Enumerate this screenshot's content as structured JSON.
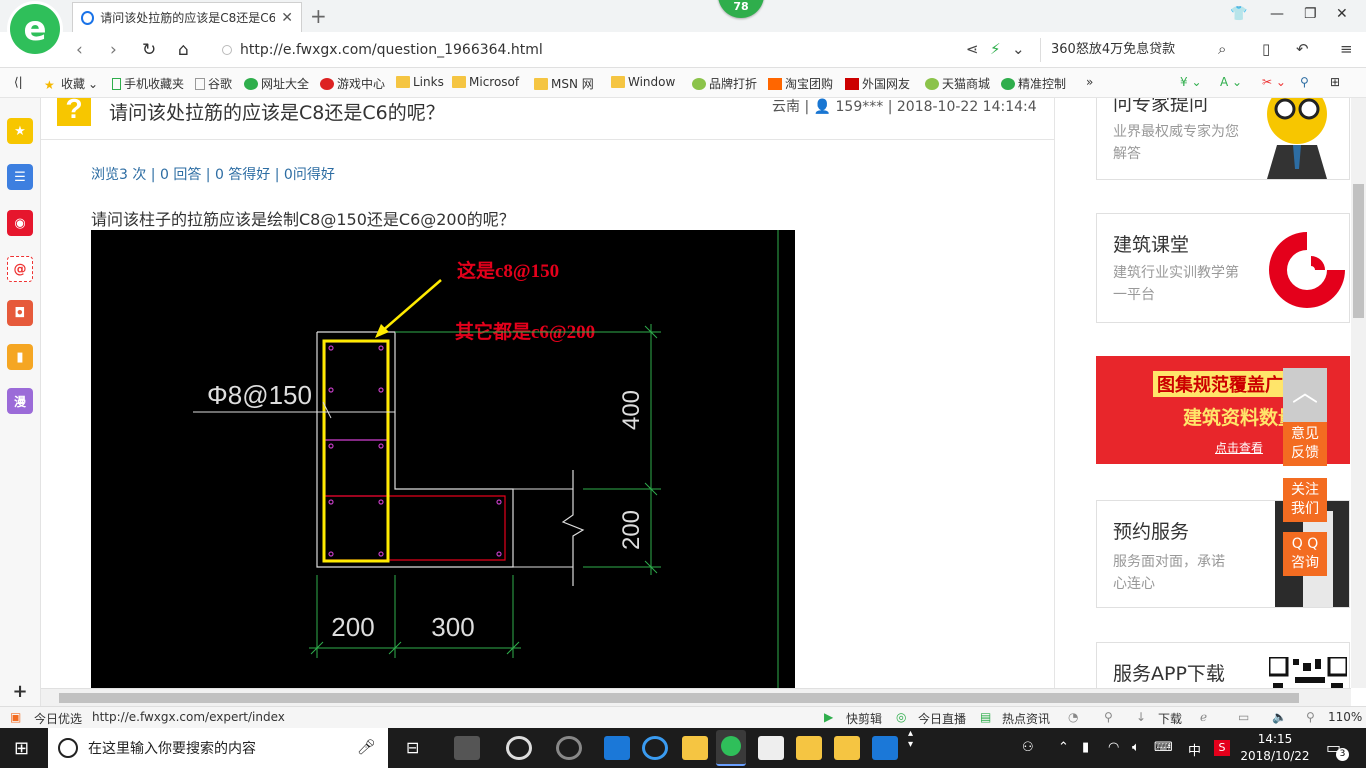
{
  "browser": {
    "tab_title": "请问该处拉筋的应该是C8还是C6的呢？",
    "badge_count": "78",
    "url": "http://e.fwxgx.com/question_1966364.html",
    "search_text": "360怒放4万免息贷款"
  },
  "bookmarks": [
    "收藏",
    "手机收藏夹",
    "谷歌",
    "网址大全",
    "游戏中心",
    "Links",
    "Microsof",
    "MSN 网",
    "Window",
    "品牌打折",
    "淘宝团购",
    "外国网友",
    "天猫商城",
    "精准控制"
  ],
  "question": {
    "title": "请问该处拉筋的应该是C8还是C6的呢？",
    "region": "云南",
    "user": "159***",
    "datetime": "2018-10-22 14:14:4",
    "stats": "浏览3 次 | 0 回答 | 0 答得好 | 0问得好",
    "body": "请问该柱子的拉筋应该是绘制C8@150还是C6@200的呢？"
  },
  "drawing": {
    "rebar_label": "Φ8@150",
    "annot1": "这是c8@150",
    "annot2": "其它都是c6@200",
    "dim_400": "400",
    "dim_200v": "200",
    "dim_200h": "200",
    "dim_300": "300"
  },
  "sidebar_cards": {
    "expert_title": "问专家提问",
    "expert_desc": "业界最权威专家为您解答",
    "class_title": "建筑课堂",
    "class_desc": "建筑行业实训教学第一平台",
    "banner_line1": "图集规范覆盖广",
    "banner_line2": "建筑资料数量多",
    "banner_cta": "点击查看",
    "service_title": "预约服务",
    "service_desc": "服务面对面，承诺心连心",
    "app_title": "服务APP下载"
  },
  "float_buttons": [
    "意见反馈",
    "关注我们",
    "Q Q咨询"
  ],
  "statusbar": {
    "left_label": "今日优选",
    "hover_url": "http://e.fwxgx.com/expert/index",
    "items": [
      "快剪辑",
      "今日直播",
      "热点资讯",
      "下载"
    ],
    "zoom": "110%"
  },
  "taskbar": {
    "search_placeholder": "在这里输入你要搜索的内容",
    "ime": "中",
    "time": "14:15",
    "date": "2018/10/22",
    "notifications": "3"
  },
  "colors": {
    "accent_green": "#2fbf5a",
    "link_blue": "#2d6da3",
    "float_orange": "#f36c21",
    "cad_yellow": "#ffeb00",
    "cad_red": "#e4001b"
  }
}
